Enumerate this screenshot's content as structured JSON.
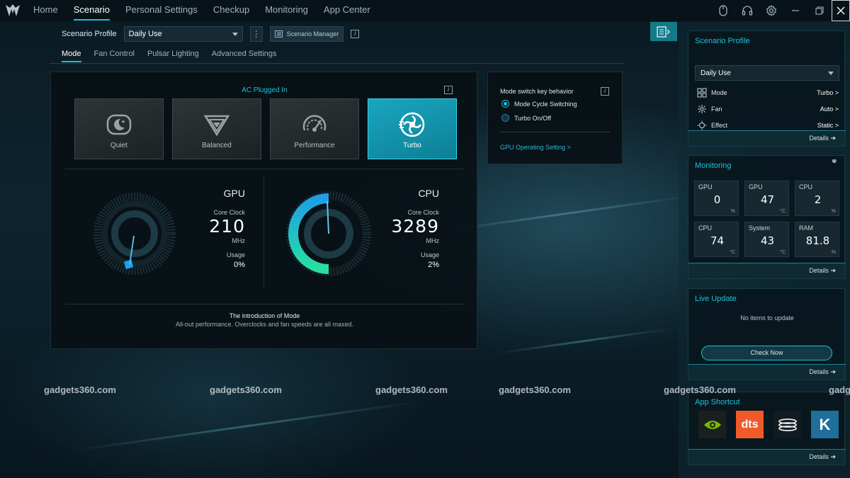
{
  "nav": {
    "items": [
      "Home",
      "Scenario",
      "Personal Settings",
      "Checkup",
      "Monitoring",
      "App Center"
    ],
    "active": "Scenario"
  },
  "window_icons": [
    "mouse-icon",
    "headset-icon",
    "settings-icon",
    "minimize-icon",
    "restore-icon",
    "close-icon"
  ],
  "profile": {
    "label": "Scenario Profile",
    "selected": "Daily Use",
    "manager_label": "Scenario Manager"
  },
  "subtabs": [
    "Mode",
    "Fan Control",
    "Pulsar Lighting",
    "Advanced Settings"
  ],
  "mode_panel": {
    "power_state": "AC Plugged In",
    "modes": [
      {
        "label": "Quiet",
        "icon": "quiet-icon",
        "active": false
      },
      {
        "label": "Balanced",
        "icon": "balanced-icon",
        "active": false
      },
      {
        "label": "Performance",
        "icon": "performance-icon",
        "active": false
      },
      {
        "label": "Turbo",
        "icon": "turbo-icon",
        "active": true
      }
    ],
    "gpu": {
      "title": "GPU",
      "clock_label": "Core Clock",
      "clock": "210",
      "clock_unit": "MHz",
      "usage_label": "Usage",
      "usage": "0%"
    },
    "cpu": {
      "title": "CPU",
      "clock_label": "Core Clock",
      "clock": "3289",
      "clock_unit": "MHz",
      "usage_label": "Usage",
      "usage": "2%"
    },
    "intro_title": "The introduction of Mode",
    "intro_desc": "All-out performance. Overclocks and fan speeds are all maxed."
  },
  "behavior": {
    "title": "Mode switch key behavior",
    "options": [
      {
        "label": "Mode Cycle Switching",
        "selected": true
      },
      {
        "label": "Turbo On/Off",
        "selected": false
      }
    ],
    "link": "GPU Operating Setting >"
  },
  "sidebar": {
    "scenario": {
      "title": "Scenario Profile",
      "selected": "Daily Use",
      "rows": [
        {
          "label": "Mode",
          "value": "Turbo >",
          "icon": "mode-grid-icon"
        },
        {
          "label": "Fan",
          "value": "Auto >",
          "icon": "fan-icon"
        },
        {
          "label": "Effect",
          "value": "Static >",
          "icon": "effect-icon"
        }
      ],
      "details": "Details"
    },
    "monitoring": {
      "title": "Monitoring",
      "cells": [
        {
          "label": "GPU",
          "value": "0",
          "unit": "%"
        },
        {
          "label": "GPU",
          "value": "47",
          "unit": "°C"
        },
        {
          "label": "CPU",
          "value": "2",
          "unit": "%"
        },
        {
          "label": "CPU",
          "value": "74",
          "unit": "°C"
        },
        {
          "label": "System",
          "value": "43",
          "unit": "°C"
        },
        {
          "label": "RAM",
          "value": "81.8",
          "unit": "%"
        }
      ],
      "details": "Details"
    },
    "live_update": {
      "title": "Live Update",
      "empty": "No items to update",
      "button": "Check Now",
      "details": "Details"
    },
    "app_shortcut": {
      "title": "App Shortcut",
      "apps": [
        "nvidia-icon",
        "dts-icon",
        "app-coil-icon",
        "killer-icon"
      ],
      "dts_text": "dts",
      "k_text": "K",
      "details": "Details"
    }
  },
  "watermark": [
    "gadgets360.com",
    "gadgets360.com",
    "gadgets360.com",
    "gadgets360.com",
    "gadgets360.com",
    "gadg"
  ],
  "colors": {
    "accent": "#1fc0d8",
    "gauge_blue": "#1e9fe8",
    "gauge_green": "#27e0a0"
  }
}
